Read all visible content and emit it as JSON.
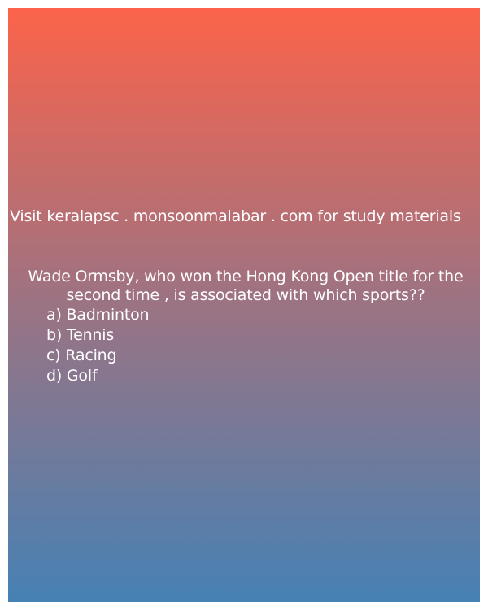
{
  "promo": {
    "text": "Visit keralapsc . monsoonmalabar . com for study materials"
  },
  "question": {
    "text": "Wade Ormsby, who won the Hong Kong Open title for the second time , is associated with which sports??"
  },
  "options": [
    {
      "label": "a) Badminton"
    },
    {
      "label": "b) Tennis"
    },
    {
      "label": "c) Racing"
    },
    {
      "label": "d) Golf"
    }
  ],
  "colors": {
    "gradient_top": "#fc634a",
    "gradient_bottom": "#4681b4",
    "text": "#ffffff"
  }
}
